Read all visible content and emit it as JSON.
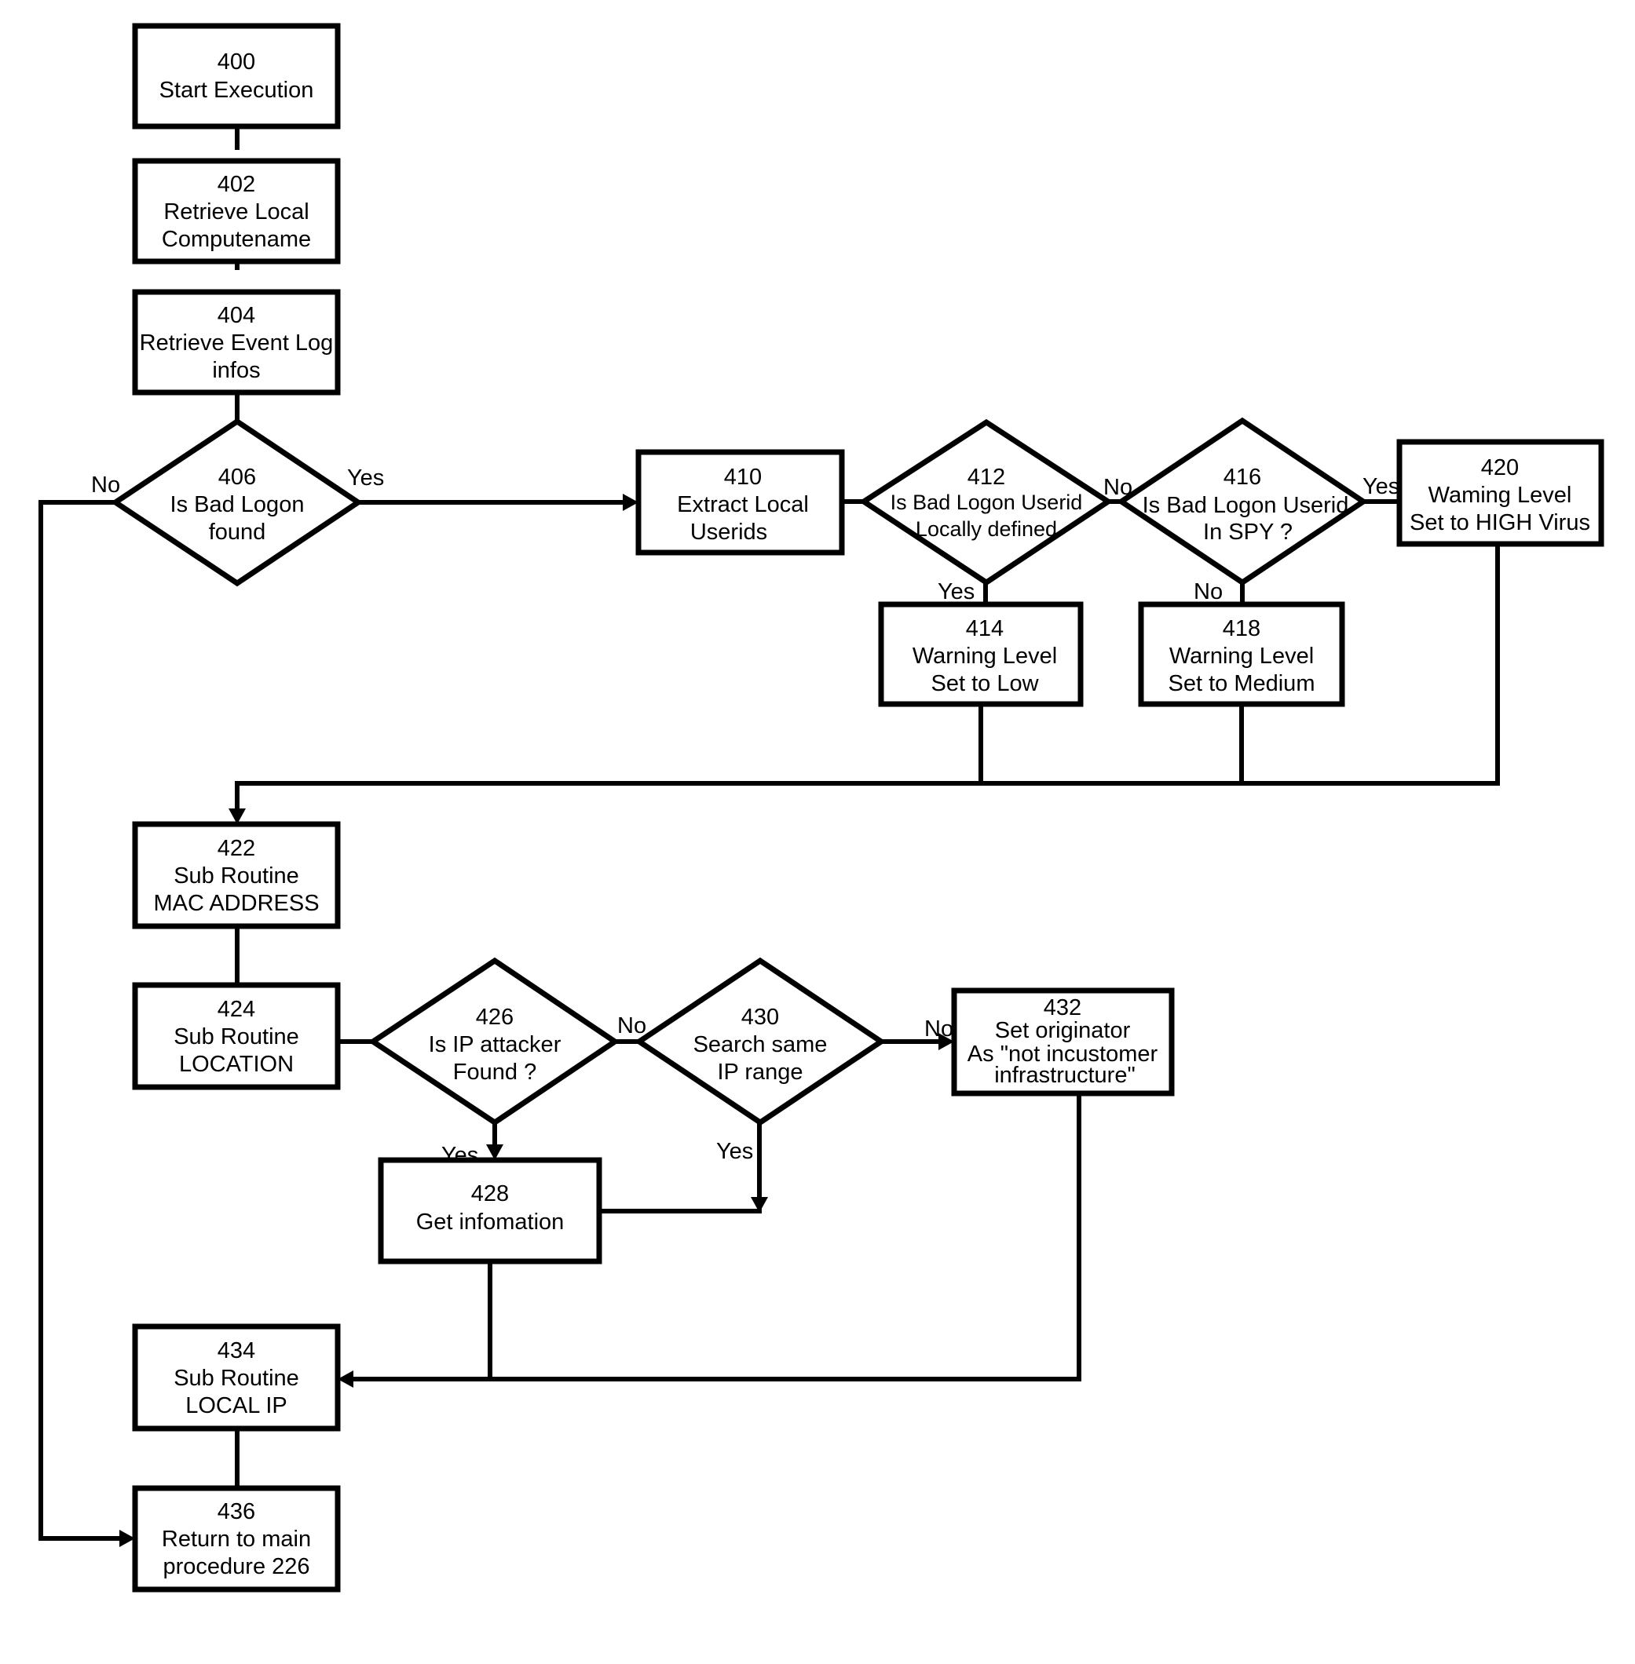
{
  "diagram": {
    "type": "flowchart",
    "nodes": {
      "n400": {
        "id": "400",
        "kind": "process",
        "lines": [
          "Start Execution"
        ]
      },
      "n402": {
        "id": "402",
        "kind": "process",
        "lines": [
          "Retrieve Local",
          "Computename"
        ]
      },
      "n404": {
        "id": "404",
        "kind": "process",
        "lines": [
          "Retrieve Event Log",
          "infos"
        ]
      },
      "n406": {
        "id": "406",
        "kind": "decision",
        "lines": [
          "Is Bad Logon",
          "found"
        ]
      },
      "n410": {
        "id": "410",
        "kind": "process",
        "lines": [
          "Extract Local",
          "Userids"
        ]
      },
      "n412": {
        "id": "412",
        "kind": "decision",
        "lines": [
          "Is Bad Logon Userid",
          "Locally defined"
        ]
      },
      "n414": {
        "id": "414",
        "kind": "process",
        "lines": [
          "Warning Level",
          "Set to Low"
        ]
      },
      "n416": {
        "id": "416",
        "kind": "decision",
        "lines": [
          "Is Bad Logon Userid",
          "In SPY ?"
        ]
      },
      "n418": {
        "id": "418",
        "kind": "process",
        "lines": [
          "Warning Level",
          "Set to Medium"
        ]
      },
      "n420": {
        "id": "420",
        "kind": "process",
        "lines": [
          "Waming Level",
          "Set to HIGH Virus"
        ]
      },
      "n422": {
        "id": "422",
        "kind": "process",
        "lines": [
          "Sub Routine",
          "MAC ADDRESS"
        ]
      },
      "n424": {
        "id": "424",
        "kind": "process",
        "lines": [
          "Sub Routine",
          "LOCATION"
        ]
      },
      "n426": {
        "id": "426",
        "kind": "decision",
        "lines": [
          "Is IP attacker",
          "Found ?"
        ]
      },
      "n428": {
        "id": "428",
        "kind": "process",
        "lines": [
          "Get infomation"
        ]
      },
      "n430": {
        "id": "430",
        "kind": "decision",
        "lines": [
          "Search same",
          "IP range"
        ]
      },
      "n432": {
        "id": "432",
        "kind": "process",
        "lines": [
          "Set originator",
          "As \"not incustomer",
          "infrastructure\""
        ]
      },
      "n434": {
        "id": "434",
        "kind": "process",
        "lines": [
          "Sub Routine",
          "LOCAL IP"
        ]
      },
      "n436": {
        "id": "436",
        "kind": "process",
        "lines": [
          "Return to main",
          "procedure 226"
        ]
      }
    },
    "edge_labels": {
      "e406_no": "No",
      "e406_yes": "Yes",
      "e412_no": "No",
      "e412_yes": "Yes",
      "e416_yes": "Yes",
      "e416_no": "No",
      "e426_no": "No",
      "e426_yes": "Yes",
      "e430_no": "No",
      "e430_yes": "Yes"
    },
    "edges": [
      {
        "from": "400",
        "to": "402"
      },
      {
        "from": "402",
        "to": "404"
      },
      {
        "from": "404",
        "to": "406"
      },
      {
        "from": "406",
        "to": "410",
        "label": "Yes"
      },
      {
        "from": "406",
        "to": "436",
        "label": "No"
      },
      {
        "from": "410",
        "to": "412"
      },
      {
        "from": "412",
        "to": "414",
        "label": "Yes"
      },
      {
        "from": "412",
        "to": "416",
        "label": "No"
      },
      {
        "from": "416",
        "to": "420",
        "label": "Yes"
      },
      {
        "from": "416",
        "to": "418",
        "label": "No"
      },
      {
        "from": "414",
        "to": "422"
      },
      {
        "from": "418",
        "to": "422"
      },
      {
        "from": "420",
        "to": "422"
      },
      {
        "from": "422",
        "to": "424"
      },
      {
        "from": "424",
        "to": "426"
      },
      {
        "from": "426",
        "to": "428",
        "label": "Yes"
      },
      {
        "from": "426",
        "to": "430",
        "label": "No"
      },
      {
        "from": "430",
        "to": "432",
        "label": "No"
      },
      {
        "from": "430",
        "to": "428-join",
        "label": "Yes"
      },
      {
        "from": "428",
        "to": "434"
      },
      {
        "from": "432",
        "to": "434"
      },
      {
        "from": "434",
        "to": "436"
      }
    ]
  }
}
